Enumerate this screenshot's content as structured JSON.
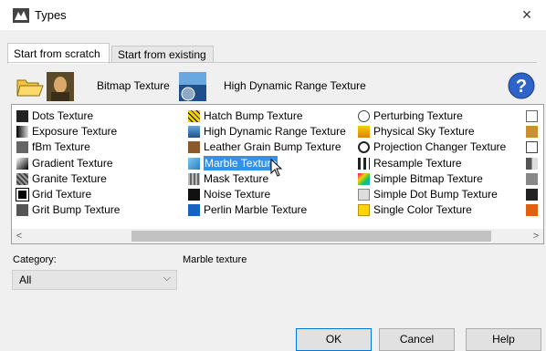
{
  "window": {
    "title": "Types",
    "close_glyph": "×"
  },
  "tabs": [
    {
      "label": "Start from scratch"
    },
    {
      "label": "Start from existing"
    }
  ],
  "quick": {
    "bitmap_label": "Bitmap Texture",
    "hdr_label": "High Dynamic Range Texture",
    "help_glyph": "?"
  },
  "textures": {
    "col1": [
      {
        "label": "Dots Texture",
        "icon": "dots-icon",
        "color": "#222222"
      },
      {
        "label": "Exposure Texture",
        "icon": "exposure-icon",
        "color": "#111111"
      },
      {
        "label": "fBm Texture",
        "icon": "fbm-icon",
        "color": "#555555"
      },
      {
        "label": "Gradient Texture",
        "icon": "gradient-icon",
        "color": "#333333"
      },
      {
        "label": "Granite Texture",
        "icon": "granite-icon",
        "color": "#777777"
      },
      {
        "label": "Grid Texture",
        "icon": "grid-icon",
        "color": "#000000"
      },
      {
        "label": "Grit Bump Texture",
        "icon": "grit-icon",
        "color": "#444444"
      }
    ],
    "col2": [
      {
        "label": "Hatch Bump Texture",
        "icon": "hatch-icon",
        "color": "#e8c400"
      },
      {
        "label": "High Dynamic Range Texture",
        "icon": "hdr-icon",
        "color": "#2a5a9a"
      },
      {
        "label": "Leather Grain Bump Texture",
        "icon": "leather-icon",
        "color": "#8b5a2b"
      },
      {
        "label": "Marble Texture",
        "icon": "marble-icon",
        "color": "#3aa0e0",
        "selected": true
      },
      {
        "label": "Mask Texture",
        "icon": "mask-icon",
        "color": "#888888"
      },
      {
        "label": "Noise Texture",
        "icon": "noise-icon",
        "color": "#111111"
      },
      {
        "label": "Perlin Marble Texture",
        "icon": "perlin-icon",
        "color": "#1565c0"
      }
    ],
    "col3": [
      {
        "label": "Perturbing Texture",
        "icon": "perturbing-icon",
        "color": "#666666"
      },
      {
        "label": "Physical Sky Texture",
        "icon": "sky-icon",
        "color": "#e8c400"
      },
      {
        "label": "Projection Changer Texture",
        "icon": "projection-icon",
        "color": "#222222"
      },
      {
        "label": "Resample Texture",
        "icon": "resample-icon",
        "color": "#333333"
      },
      {
        "label": "Simple Bitmap Texture",
        "icon": "simple-bitmap-icon",
        "color": "#7cc8f0"
      },
      {
        "label": "Simple Dot Bump Texture",
        "icon": "simple-dot-icon",
        "color": "#cccccc"
      },
      {
        "label": "Single Color Texture",
        "icon": "single-color-icon",
        "color": "#ffd400"
      }
    ],
    "col4_icons": [
      {
        "icon": "blank-icon",
        "color": "#ffffff"
      },
      {
        "icon": "tile-icon",
        "color": "#c89030"
      },
      {
        "icon": "wave-icon",
        "color": "#444444"
      },
      {
        "icon": "split-icon",
        "color": "#555555"
      },
      {
        "icon": "stone-icon",
        "color": "#777777"
      },
      {
        "icon": "wood-icon",
        "color": "#222222"
      },
      {
        "icon": "orange-icon",
        "color": "#e06010"
      }
    ]
  },
  "scroll": {
    "left_glyph": "<",
    "right_glyph": ">"
  },
  "category": {
    "label": "Category:",
    "value": "All",
    "chevron": "⌵"
  },
  "description": "Marble texture",
  "buttons": {
    "ok": "OK",
    "cancel": "Cancel",
    "help": "Help"
  }
}
